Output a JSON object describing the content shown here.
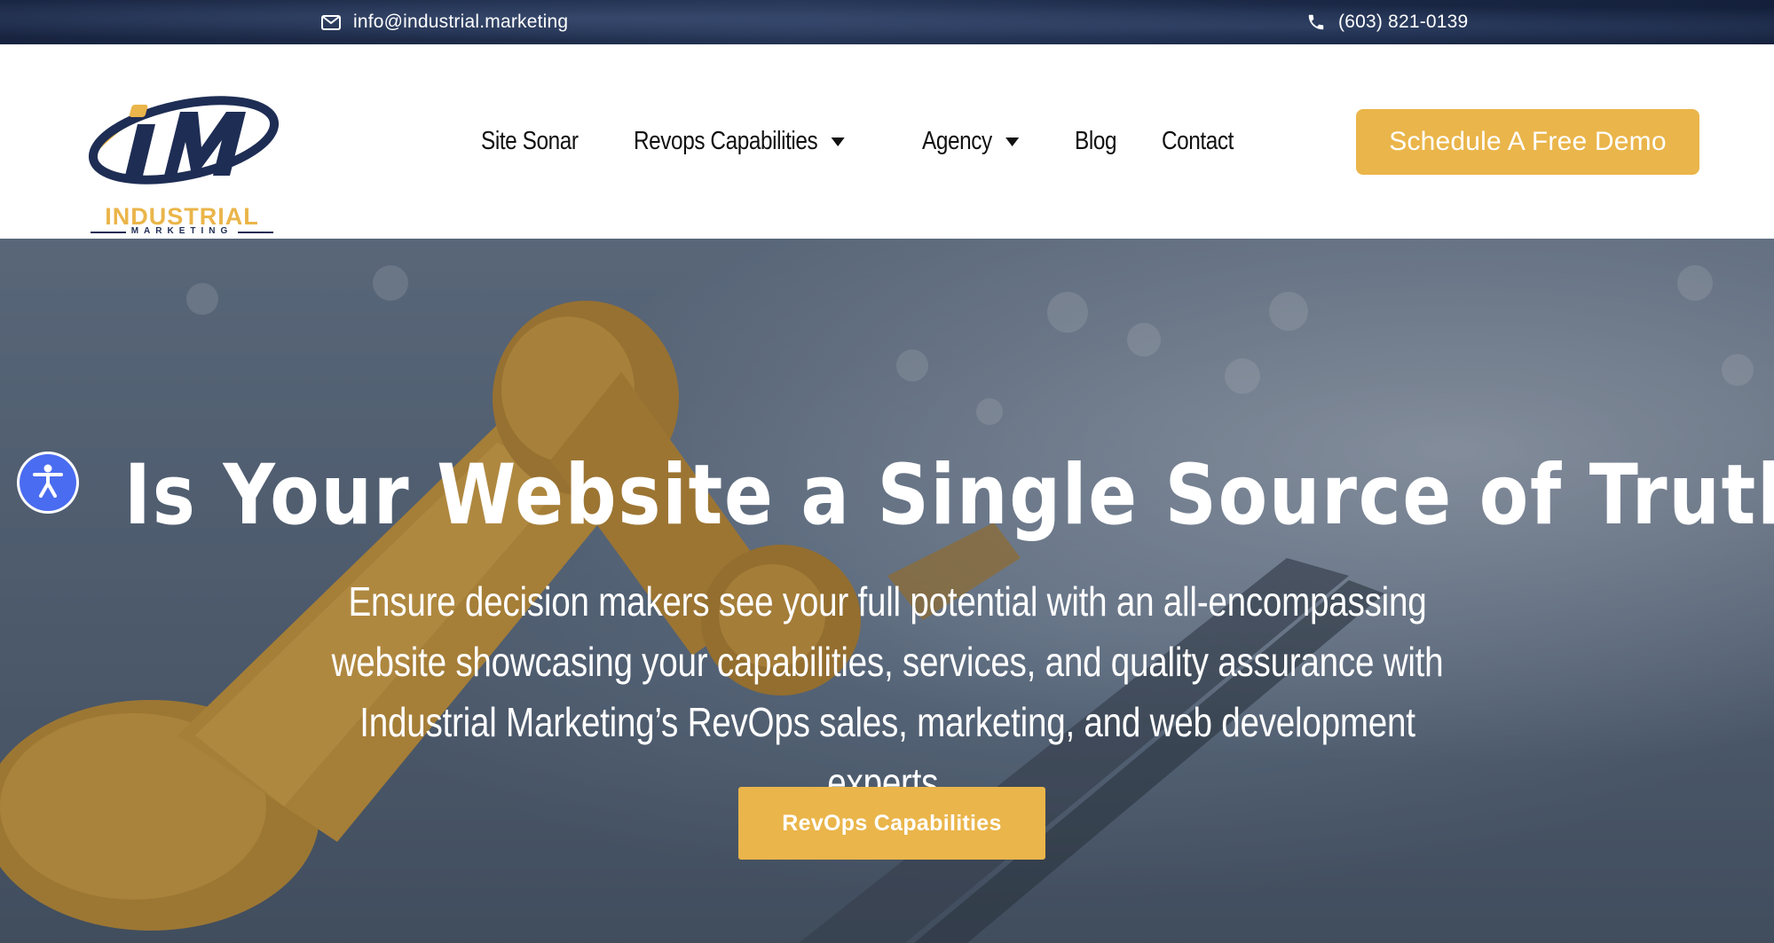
{
  "topbar": {
    "email": "info@industrial.marketing",
    "phone": "(603) 821-0139",
    "email_icon": "envelope-icon",
    "phone_icon": "phone-icon"
  },
  "header": {
    "logo_text": "INDUSTRIAL",
    "logo_subtext": "MARKETING",
    "nav": [
      {
        "label": "Site Sonar",
        "has_dropdown": false
      },
      {
        "label": "Revops Capabilities",
        "has_dropdown": true
      },
      {
        "label": "Agency",
        "has_dropdown": true
      },
      {
        "label": "Blog",
        "has_dropdown": false
      },
      {
        "label": "Contact",
        "has_dropdown": false
      }
    ],
    "cta_label": "Schedule A Free Demo"
  },
  "hero": {
    "headline": "Is Your Website a Single Source of Truth?",
    "subtext": "Ensure decision makers see your full potential with an all-encompassing website showcasing your capabilities, services, and quality assurance with Industrial Marketing’s RevOps sales, marketing, and web development experts.",
    "cta_label": "RevOps Capabilities"
  },
  "accessibility": {
    "icon": "accessibility-icon"
  },
  "colors": {
    "accent": "#eab54a",
    "brand_navy": "#1e2d54",
    "accessibility_blue": "#4a6cf0"
  }
}
